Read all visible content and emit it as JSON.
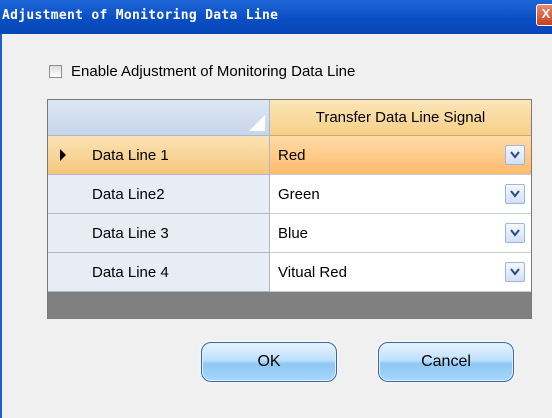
{
  "window": {
    "title": "Adjustment of Monitoring Data Line",
    "close_label": "X"
  },
  "checkbox": {
    "label": "Enable Adjustment of Monitoring Data Line",
    "checked": false
  },
  "grid": {
    "column_header": "Transfer Data Line Signal",
    "rows": [
      {
        "label": "Data Line 1",
        "value": "Red",
        "selected": true
      },
      {
        "label": "Data Line2",
        "value": "Green",
        "selected": false
      },
      {
        "label": "Data Line 3",
        "value": "Blue",
        "selected": false
      },
      {
        "label": "Data Line 4",
        "value": "Vitual Red",
        "selected": false
      }
    ]
  },
  "buttons": {
    "ok": "OK",
    "cancel": "Cancel"
  },
  "colors": {
    "title_bar": "#0a4ec4",
    "selected_row": "#ffba6c",
    "button": "#8ec8f4"
  },
  "icons": {
    "row_marker": "triangle-right-icon",
    "dropdown": "chevron-down-icon",
    "close": "close-icon"
  }
}
